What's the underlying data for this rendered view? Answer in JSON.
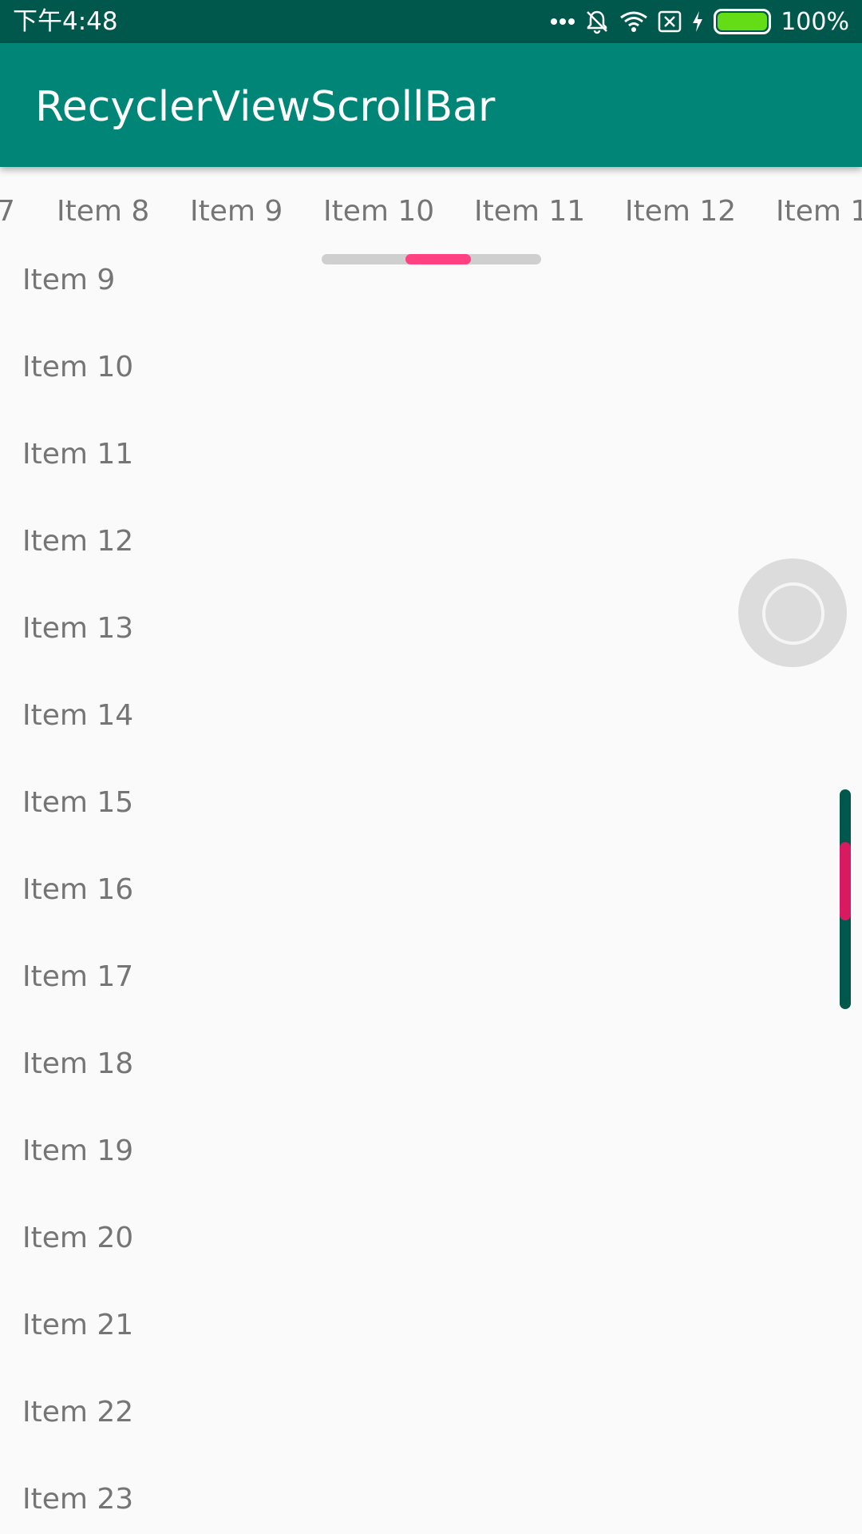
{
  "status_bar": {
    "time": "下午4:48",
    "battery_percent": "100%",
    "icons": [
      "more-dots-icon",
      "mute-icon",
      "wifi-icon",
      "sim-x-icon",
      "charging-bolt-icon",
      "battery-icon"
    ]
  },
  "app_bar": {
    "title": "RecyclerViewScrollBar"
  },
  "horizontal_list": {
    "items": [
      "7",
      "Item 8",
      "Item 9",
      "Item 10",
      "Item 11",
      "Item 12",
      "Item 1"
    ]
  },
  "vertical_list": {
    "items": [
      "Item 9",
      "Item 10",
      "Item 11",
      "Item 12",
      "Item 13",
      "Item 14",
      "Item 15",
      "Item 16",
      "Item 17",
      "Item 18",
      "Item 19",
      "Item 20",
      "Item 21",
      "Item 22",
      "Item 23"
    ]
  },
  "colors": {
    "status_bar": "#00574b",
    "app_bar": "#008577",
    "h_scroll_track": "#cfcfcf",
    "h_scroll_thumb": "#ff4081",
    "v_scroll_track": "#00574b",
    "v_scroll_thumb": "#d81b60",
    "battery_fill": "#64dd17"
  }
}
